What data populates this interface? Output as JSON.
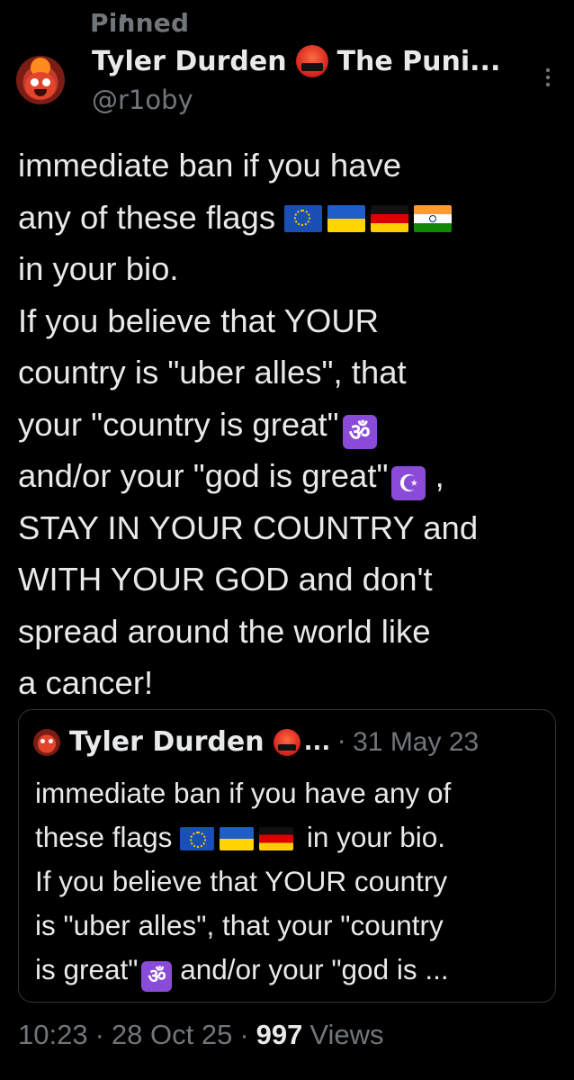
{
  "pinned": {
    "label": "Pinned"
  },
  "author": {
    "display_name": "Tyler Durden",
    "name_suffix": "The Puni...",
    "handle": "@r1oby"
  },
  "tweet": {
    "lines": [
      "immediate ban if you have",
      "any of these flags",
      "in your bio.",
      "If you believe that YOUR",
      "country is \"uber alles\", that",
      "your \"country is great\"",
      "and/or your \"god is great\"",
      ",",
      "STAY IN YOUR COUNTRY and",
      "WITH YOUR GOD and don't",
      "spread around the world like",
      "a cancer!"
    ],
    "om_symbol": "ॐ",
    "crescent_symbol": "☪"
  },
  "quote": {
    "name": "Tyler Durden",
    "ellipsis": "...",
    "separator": "·",
    "date": "31 May 23",
    "lines": [
      "immediate ban if you have any of",
      "these flags",
      "in your bio.",
      "If you believe that YOUR country",
      "is \"uber alles\", that your \"country",
      "is great\"",
      "and/or your \"god is ..."
    ]
  },
  "meta": {
    "time": "10:23",
    "separator": "·",
    "date": "28 Oct 25",
    "views_count": "997",
    "views_label": "Views"
  },
  "colors": {
    "background": "#000000",
    "text": "#e7e9ea",
    "muted": "#71767b",
    "symbol_purple": "#8a4bd8"
  }
}
